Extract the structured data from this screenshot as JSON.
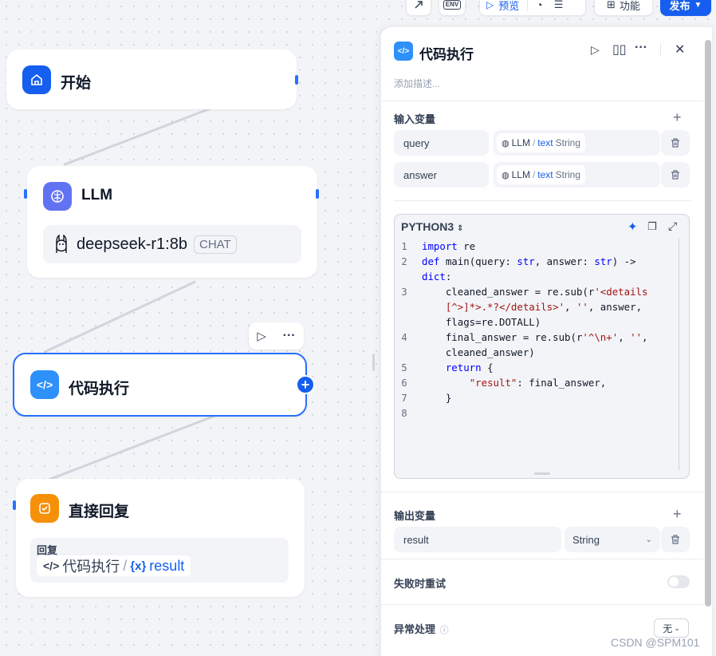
{
  "toolbar": {
    "env_label": "ENV",
    "preview_label": "预览",
    "features_label": "功能",
    "publish_label": "发布"
  },
  "canvas": {
    "start_node": {
      "title": "开始",
      "icon": "home-icon"
    },
    "llm_node": {
      "title": "LLM",
      "model": "deepseek-r1:8b",
      "mode_badge": "CHAT"
    },
    "code_node": {
      "title": "代码执行"
    },
    "answer_node": {
      "title": "直接回复",
      "reply_label": "回复",
      "ref_node": "代码执行",
      "ref_sep": "/",
      "ref_var_prefix": "{x}",
      "ref_var": "result"
    }
  },
  "panel": {
    "title": "代码执行",
    "description_placeholder": "添加描述...",
    "input_section": "输入变量",
    "inputs": [
      {
        "name": "query",
        "source": "LLM",
        "sep": "/",
        "var": "text",
        "type": "String"
      },
      {
        "name": "answer",
        "source": "LLM",
        "sep": "/",
        "var": "text",
        "type": "String"
      }
    ],
    "code": {
      "language": "PYTHON3",
      "lines": [
        {
          "n": "1",
          "html": "<span class=\"kw\">import</span> re"
        },
        {
          "n": "2",
          "html": "<span class=\"kw\">def</span> main(query: <span class=\"kw\">str</span>, answer: <span class=\"kw\">str</span>) -> \n<span class=\"kw\">dict</span>:"
        },
        {
          "n": "3",
          "html": "    cleaned_answer = re.sub(r<span class=\"st\">'&lt;details\n    [^&gt;]*&gt;.*?&lt;/details&gt;'</span>, <span class=\"st\">''</span>, answer,\n    flags=re.DOTALL)"
        },
        {
          "n": "4",
          "html": "    final_answer = re.sub(r<span class=\"st\">'^\\n+'</span>, <span class=\"st\">''</span>,\n    cleaned_answer)"
        },
        {
          "n": "5",
          "html": "    <span class=\"kw\">return</span> {"
        },
        {
          "n": "6",
          "html": "        <span class=\"st\">\"result\"</span>: final_answer,"
        },
        {
          "n": "7",
          "html": "    }"
        },
        {
          "n": "8",
          "html": ""
        }
      ]
    },
    "output_section": "输出变量",
    "outputs": [
      {
        "name": "result",
        "type": "String"
      }
    ],
    "retry_label": "失败时重试",
    "retry_enabled": false,
    "error_label": "异常处理",
    "error_value": "无"
  },
  "watermark": "CSDN @SPM101",
  "colors": {
    "accent": "#155eef",
    "llm": "#6172f3",
    "code": "#2e90fa",
    "answer": "#f79009"
  }
}
